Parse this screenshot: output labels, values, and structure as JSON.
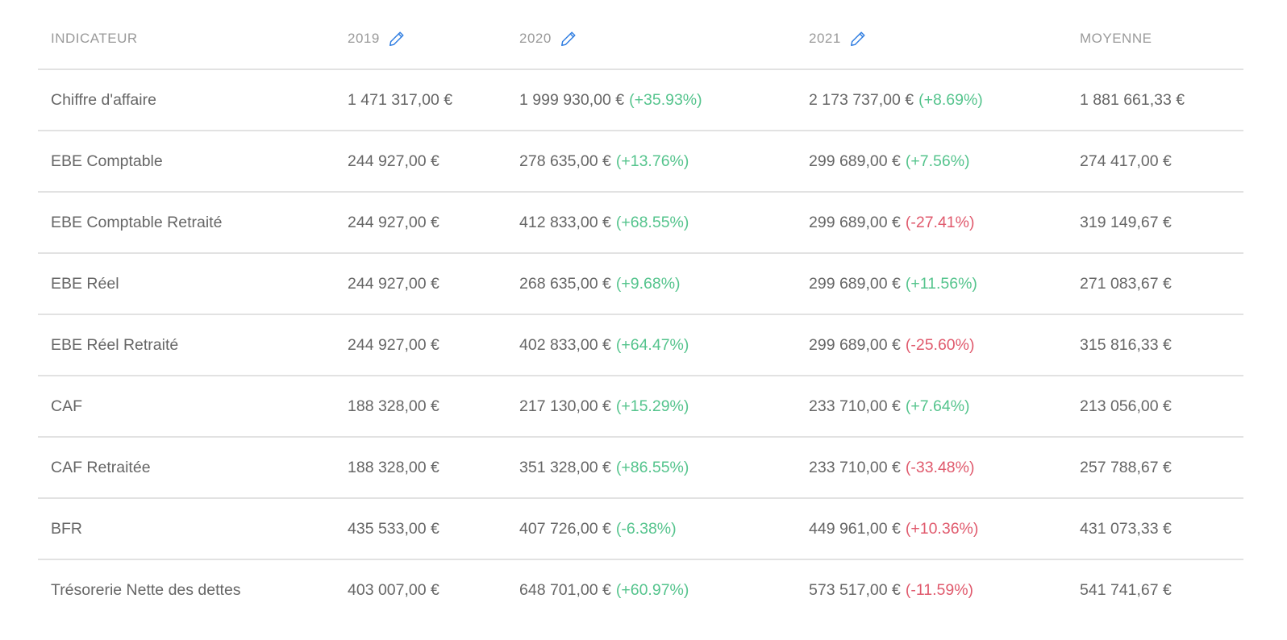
{
  "header": {
    "indicator": "INDICATEUR",
    "years": [
      "2019",
      "2020",
      "2021"
    ],
    "average": "MOYENNE",
    "edit_icon": "pencil-icon",
    "edit_icon_color": "#2f7de1"
  },
  "colors": {
    "text": "#666666",
    "header_text": "#9a9a9a",
    "positive": "#55c48d",
    "negative": "#e05a6d",
    "divider": "#e2e2e2"
  },
  "rows": [
    {
      "label": "Chiffre d'affaire",
      "v2019": "1 471 317,00 €",
      "v2020": "1 999 930,00 €",
      "p2020": "(+35.93%)",
      "t2020": "up",
      "v2021": "2 173 737,00 €",
      "p2021": "(+8.69%)",
      "t2021": "up",
      "avg": "1 881 661,33 €"
    },
    {
      "label": "EBE Comptable",
      "v2019": "244 927,00 €",
      "v2020": "278 635,00 €",
      "p2020": "(+13.76%)",
      "t2020": "up",
      "v2021": "299 689,00 €",
      "p2021": "(+7.56%)",
      "t2021": "up",
      "avg": "274 417,00 €"
    },
    {
      "label": "EBE Comptable Retraité",
      "v2019": "244 927,00 €",
      "v2020": "412 833,00 €",
      "p2020": "(+68.55%)",
      "t2020": "up",
      "v2021": "299 689,00 €",
      "p2021": "(-27.41%)",
      "t2021": "down",
      "avg": "319 149,67 €"
    },
    {
      "label": "EBE Réel",
      "v2019": "244 927,00 €",
      "v2020": "268 635,00 €",
      "p2020": "(+9.68%)",
      "t2020": "up",
      "v2021": "299 689,00 €",
      "p2021": "(+11.56%)",
      "t2021": "up",
      "avg": "271 083,67 €"
    },
    {
      "label": "EBE Réel Retraité",
      "v2019": "244 927,00 €",
      "v2020": "402 833,00 €",
      "p2020": "(+64.47%)",
      "t2020": "up",
      "v2021": "299 689,00 €",
      "p2021": "(-25.60%)",
      "t2021": "down",
      "avg": "315 816,33 €"
    },
    {
      "label": "CAF",
      "v2019": "188 328,00 €",
      "v2020": "217 130,00 €",
      "p2020": "(+15.29%)",
      "t2020": "up",
      "v2021": "233 710,00 €",
      "p2021": "(+7.64%)",
      "t2021": "up",
      "avg": "213 056,00 €"
    },
    {
      "label": "CAF Retraitée",
      "v2019": "188 328,00 €",
      "v2020": "351 328,00 €",
      "p2020": "(+86.55%)",
      "t2020": "up",
      "v2021": "233 710,00 €",
      "p2021": "(-33.48%)",
      "t2021": "down",
      "avg": "257 788,67 €"
    },
    {
      "label": "BFR",
      "v2019": "435 533,00 €",
      "v2020": "407 726,00 €",
      "p2020": "(-6.38%)",
      "t2020": "up",
      "v2021": "449 961,00 €",
      "p2021": "(+10.36%)",
      "t2021": "down",
      "avg": "431 073,33 €"
    },
    {
      "label": "Trésorerie Nette des dettes",
      "v2019": "403 007,00 €",
      "v2020": "648 701,00 €",
      "p2020": "(+60.97%)",
      "t2020": "up",
      "v2021": "573 517,00 €",
      "p2021": "(-11.59%)",
      "t2021": "down",
      "avg": "541 741,67 €"
    }
  ]
}
